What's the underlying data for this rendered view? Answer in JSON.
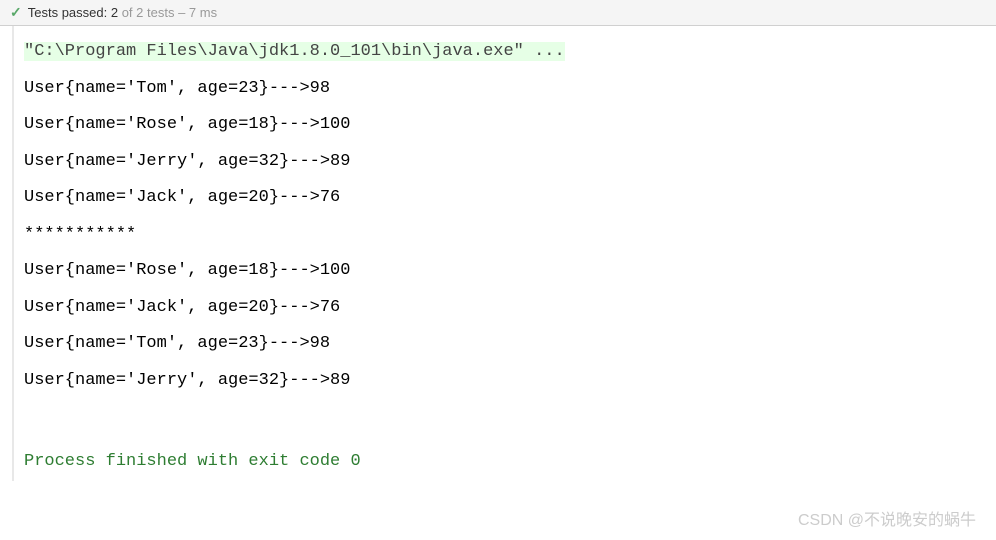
{
  "status": {
    "icon": "✓",
    "label_prefix": "Tests passed: ",
    "passed": "2",
    "of_text": " of 2 tests",
    "duration": " – 7 ms"
  },
  "console": {
    "command": "\"C:\\Program Files\\Java\\jdk1.8.0_101\\bin\\java.exe\" ...",
    "lines": [
      "User{name='Tom', age=23}--->98",
      "User{name='Rose', age=18}--->100",
      "User{name='Jerry', age=32}--->89",
      "User{name='Jack', age=20}--->76",
      "***********",
      "User{name='Rose', age=18}--->100",
      "User{name='Jack', age=20}--->76",
      "User{name='Tom', age=23}--->98",
      "User{name='Jerry', age=32}--->89"
    ],
    "process_exit": "Process finished with exit code 0"
  },
  "watermark": "CSDN @不说晚安的蜗牛"
}
